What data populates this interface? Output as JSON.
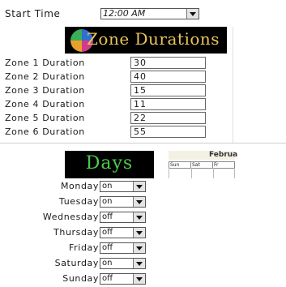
{
  "start_time": {
    "label": "Start Time",
    "value": "12:00 AM"
  },
  "zone_section": {
    "title": "Zone Durations",
    "zones": [
      {
        "label": "Zone 1 Duration",
        "value": "30"
      },
      {
        "label": "Zone 2 Duration",
        "value": "40"
      },
      {
        "label": "Zone 3 Duration",
        "value": "15"
      },
      {
        "label": "Zone 4 Duration",
        "value": "11"
      },
      {
        "label": "Zone 5 Duration",
        "value": "22"
      },
      {
        "label": "Zone 6 Duration",
        "value": "55"
      }
    ]
  },
  "days_section": {
    "title": "Days",
    "days": [
      {
        "label": "Monday",
        "value": "on"
      },
      {
        "label": "Tuesday",
        "value": "on"
      },
      {
        "label": "Wednesday",
        "value": "off"
      },
      {
        "label": "Thursday",
        "value": "off"
      },
      {
        "label": "Friday",
        "value": "off"
      },
      {
        "label": "Saturday",
        "value": "on"
      },
      {
        "label": "Sunday",
        "value": "off"
      }
    ]
  },
  "calendar": {
    "month": "Februa",
    "headers": [
      "Sun",
      "Sat",
      "Fr"
    ]
  },
  "colors": {
    "zone_title": "#e7c45a",
    "days_title": "#4ec94e",
    "banner_bg": "#000000"
  }
}
